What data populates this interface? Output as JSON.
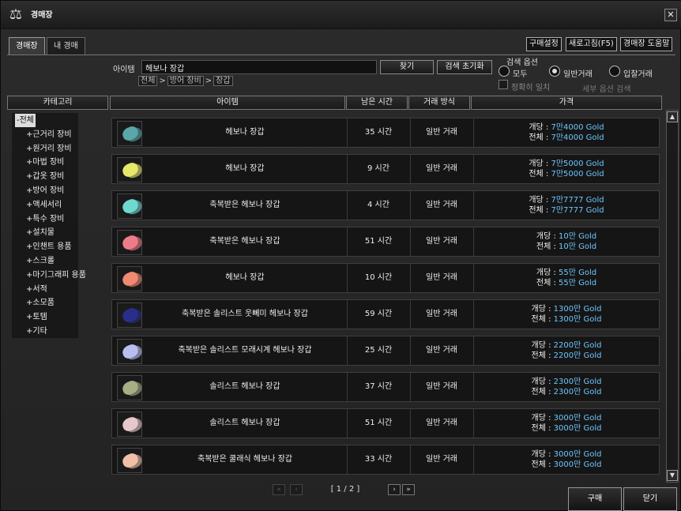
{
  "window": {
    "title": "경매장",
    "close_symbol": "✕",
    "title_icon": "scale-icon"
  },
  "tabs": [
    {
      "label": "경매장",
      "active": true
    },
    {
      "label": "내 경매",
      "active": false
    }
  ],
  "top_buttons": [
    "구매설정",
    "새로고침(F5)",
    "경매장 도움말"
  ],
  "search": {
    "label": "아이템",
    "value": "헤보나 장갑",
    "find_button": "찾기",
    "reset_button": "검색 초기화",
    "breadcrumb": [
      "전체",
      "방어 장비",
      "장갑"
    ],
    "options_title": "검색 옵션",
    "options": [
      {
        "label": "모두",
        "selected": false
      },
      {
        "label": "일반거래",
        "selected": true
      },
      {
        "label": "입찰거래",
        "selected": false
      }
    ],
    "exact_match_label": "정확히 일치",
    "detail_options_label": "세부 옵션 검색"
  },
  "columns": {
    "category": "카테고리",
    "item": "아이템",
    "time_left": "남은 시간",
    "trade_type": "거래 방식",
    "price": "가격"
  },
  "categories": [
    {
      "label": "-전체",
      "selected": true
    },
    {
      "label": "+근거리 장비",
      "selected": false
    },
    {
      "label": "+원거리 장비",
      "selected": false
    },
    {
      "label": "+마법 장비",
      "selected": false
    },
    {
      "label": "+갑옷 장비",
      "selected": false
    },
    {
      "label": "+방어 장비",
      "selected": false
    },
    {
      "label": "+액세서리",
      "selected": false
    },
    {
      "label": "+특수 장비",
      "selected": false
    },
    {
      "label": "+설치물",
      "selected": false
    },
    {
      "label": "+인챈트 용품",
      "selected": false
    },
    {
      "label": "+스크롤",
      "selected": false
    },
    {
      "label": "+마기그래피 용품",
      "selected": false
    },
    {
      "label": "+서적",
      "selected": false
    },
    {
      "label": "+소모품",
      "selected": false
    },
    {
      "label": "+토템",
      "selected": false
    },
    {
      "label": "+기타",
      "selected": false
    }
  ],
  "price_labels": {
    "each": "개당 : ",
    "total": "전체 : "
  },
  "items": [
    {
      "name": "헤보나 장갑",
      "time": "35 시간",
      "method": "일반 거래",
      "each": "7만4000 Gold",
      "total": "7만4000 Gold",
      "color": "#5aa6a8",
      "icon": "gloves-icon"
    },
    {
      "name": "헤보나 장갑",
      "time": "9 시간",
      "method": "일반 거래",
      "each": "7만5000 Gold",
      "total": "7만5000 Gold",
      "color": "#e6e86a",
      "icon": "gloves-icon"
    },
    {
      "name": "축복받은 헤보나 장갑",
      "time": "4 시간",
      "method": "일반 거래",
      "each": "7만7777 Gold",
      "total": "7만7777 Gold",
      "color": "#6fd8cf",
      "icon": "gloves-icon"
    },
    {
      "name": "축복받은 헤보나 장갑",
      "time": "51 시간",
      "method": "일반 거래",
      "each": "10만 Gold",
      "total": "10만 Gold",
      "color": "#ee7c88",
      "icon": "gloves-icon"
    },
    {
      "name": "헤보나 장갑",
      "time": "10 시간",
      "method": "일반 거래",
      "each": "55만 Gold",
      "total": "55만 Gold",
      "color": "#f08a72",
      "icon": "gloves-icon"
    },
    {
      "name": "축복받은 솔리스트 웃뻬미 헤보나 장갑",
      "time": "59 시간",
      "method": "일반 거래",
      "each": "1300만 Gold",
      "total": "1300만 Gold",
      "color": "#2a2e8a",
      "icon": "gloves-icon"
    },
    {
      "name": "축복받은 솔리스트 모래시계 헤보나 장갑",
      "time": "25 시간",
      "method": "일반 거래",
      "each": "2200만 Gold",
      "total": "2200만 Gold",
      "color": "#b8bff0",
      "icon": "gloves-icon"
    },
    {
      "name": "솔리스트 헤보나 장갑",
      "time": "37 시간",
      "method": "일반 거래",
      "each": "2300만 Gold",
      "total": "2300만 Gold",
      "color": "#a8ad86",
      "icon": "gloves-icon"
    },
    {
      "name": "솔리스트 헤보나 장갑",
      "time": "51 시간",
      "method": "일반 거래",
      "each": "3000만 Gold",
      "total": "3000만 Gold",
      "color": "#e6c8cc",
      "icon": "gloves-icon"
    },
    {
      "name": "축복받은 쿨래식 헤보나 장갑",
      "time": "33 시간",
      "method": "일반 거래",
      "each": "3000만 Gold",
      "total": "3000만 Gold",
      "color": "#f2c0a8",
      "icon": "gloves-icon"
    }
  ],
  "pager": {
    "text": "[ 1 / 2 ]",
    "first": "«",
    "prev": "‹",
    "next": "›",
    "last": "»"
  },
  "footer": {
    "buy_button": "구매",
    "close_button": "닫기"
  },
  "scroll": {
    "up": "▲",
    "down": "▼"
  }
}
